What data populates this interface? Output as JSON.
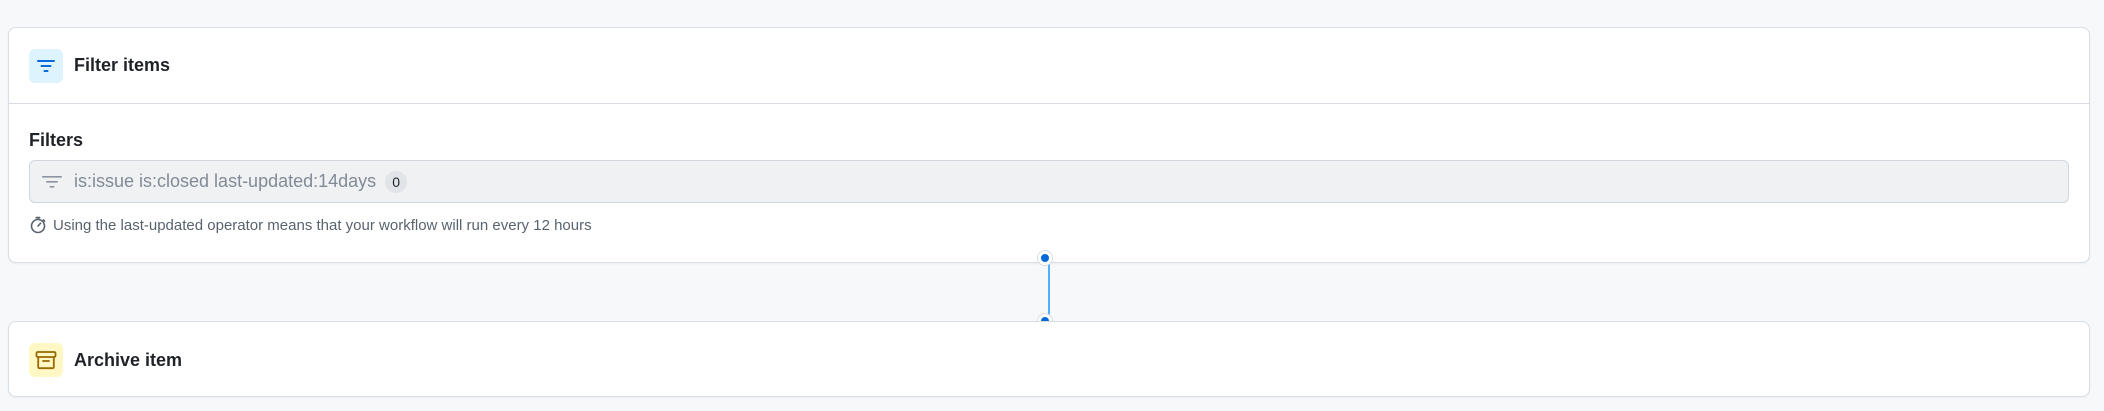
{
  "filter_step": {
    "title": "Filter items",
    "icon": "filter-icon",
    "field_label": "Filters",
    "query": "is:issue is:closed last-updated:14days",
    "match_count": "0",
    "hint_icon": "stopwatch-icon",
    "hint": "Using the last-updated operator means that your workflow will run every 12 hours"
  },
  "archive_step": {
    "title": "Archive item",
    "icon": "archive-icon"
  },
  "colors": {
    "accent": "#0969da",
    "connector": "#54aeff",
    "filter_icon_bg": "#ddf4ff",
    "archive_icon_bg": "#fff8c5",
    "archive_icon": "#9a6700"
  }
}
